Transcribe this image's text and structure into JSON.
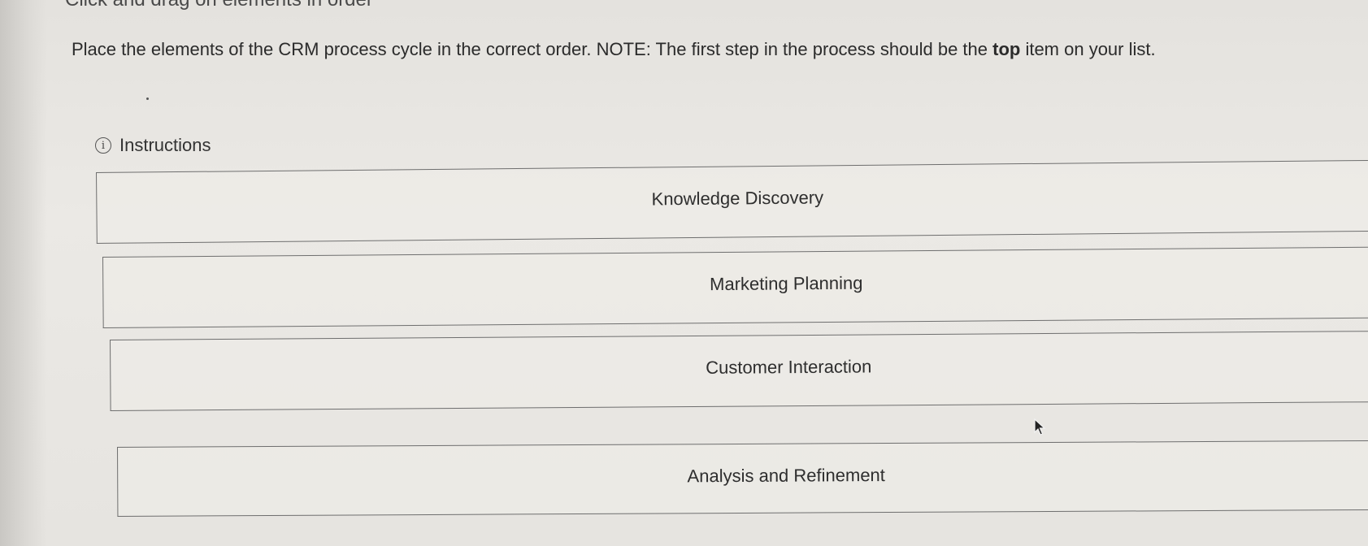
{
  "header": {
    "fragment_text": "Click and drag on elements in order"
  },
  "question": {
    "text_before_bold": "Place the elements of the CRM process cycle in the correct order. NOTE: The first step in the process should be the ",
    "bold_text": "top",
    "text_after_bold": " item on your list."
  },
  "instructions": {
    "label": "Instructions",
    "icon": "info-icon"
  },
  "drag_items": [
    {
      "label": "Knowledge Discovery"
    },
    {
      "label": "Marketing Planning"
    },
    {
      "label": "Customer Interaction"
    },
    {
      "label": "Analysis and Refinement"
    }
  ],
  "colors": {
    "background": "#e8e6e2",
    "border": "#6e6e6e",
    "text": "#2c2c2c"
  },
  "cursor": {
    "icon": "mouse-pointer-icon"
  }
}
